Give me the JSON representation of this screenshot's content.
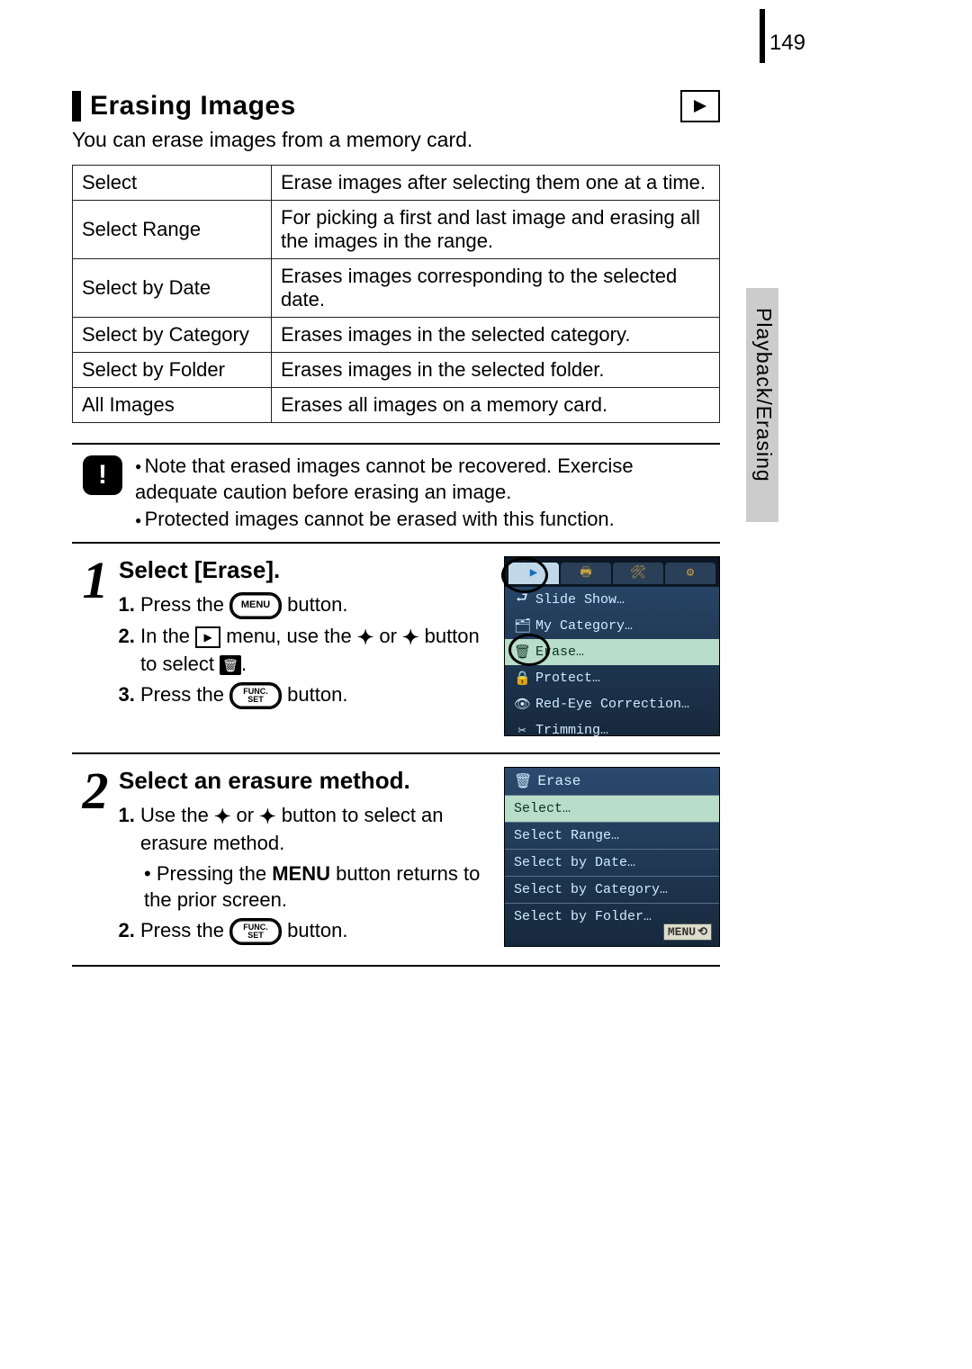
{
  "page_number": "149",
  "section_label": "Playback/Erasing",
  "title": "Erasing Images",
  "intro": "You can erase images from a memory card.",
  "table": [
    {
      "opt": "Select",
      "desc": "Erase images after selecting them one at a time."
    },
    {
      "opt": "Select Range",
      "desc": "For picking a first and last image and erasing all the images in the range."
    },
    {
      "opt": "Select by Date",
      "desc": "Erases images corresponding to the selected date."
    },
    {
      "opt": "Select by Category",
      "desc": "Erases images in the selected category."
    },
    {
      "opt": "Select by Folder",
      "desc": "Erases images in the selected folder."
    },
    {
      "opt": "All Images",
      "desc": "Erases all images on a memory card."
    }
  ],
  "notes": [
    "Note that erased images cannot be recovered. Exercise adequate caution before erasing an image.",
    "Protected images cannot be erased with this function."
  ],
  "step1": {
    "title": "Select [Erase].",
    "s1_a": "Press the ",
    "s1_b": " button.",
    "s2_a": "In the ",
    "s2_b": " menu, use the ",
    "s2_c": " or ",
    "s2_d": " button to select ",
    "s2_e": ".",
    "s3_a": "Press the ",
    "s3_b": " button.",
    "menu_btn_label": "MENU",
    "func_btn_label": "FUNC.\nSET",
    "cam_menu": {
      "items": [
        {
          "icon": "⮐",
          "label": "Slide Show…"
        },
        {
          "icon": "🗂",
          "label": "My Category…"
        },
        {
          "icon": "🗑",
          "label": "Erase…",
          "selected": true
        },
        {
          "icon": "🔒",
          "label": "Protect…"
        },
        {
          "icon": "👁",
          "label": "Red-Eye Correction…"
        },
        {
          "icon": "✂",
          "label": "Trimming…"
        }
      ]
    }
  },
  "step2": {
    "title": "Select an erasure method.",
    "s1_a": "Use the ",
    "s1_b": " or ",
    "s1_c": " button to select an erasure method.",
    "bullet_a": "Pressing the ",
    "bullet_bold": "MENU",
    "bullet_b": " button returns to the prior screen.",
    "s2_a": "Press the ",
    "s2_b": " button.",
    "cam_menu": {
      "header": "Erase",
      "items": [
        "Select…",
        "Select Range…",
        "Select by Date…",
        "Select by Category…",
        "Select by Folder…"
      ],
      "menu_label": "MENU"
    }
  }
}
